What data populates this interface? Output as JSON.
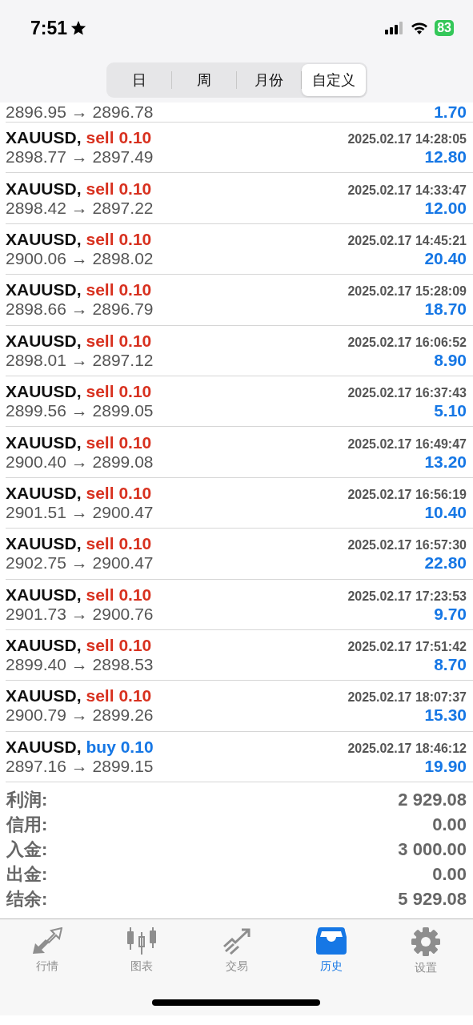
{
  "status_bar": {
    "time": "7:51",
    "battery": "83"
  },
  "period_tabs": [
    {
      "label": "日",
      "selected": false
    },
    {
      "label": "周",
      "selected": false
    },
    {
      "label": "月份",
      "selected": false
    },
    {
      "label": "自定义",
      "selected": true
    }
  ],
  "partial_deal": {
    "prices": "2896.95 → 2896.78",
    "profit": "1.70"
  },
  "deals": [
    {
      "symbol": "XAUUSD,",
      "side": "sell",
      "volume": "0.10",
      "time": "2025.02.17 14:28:05",
      "prices": "2898.77 → 2897.49",
      "profit": "12.80"
    },
    {
      "symbol": "XAUUSD,",
      "side": "sell",
      "volume": "0.10",
      "time": "2025.02.17 14:33:47",
      "prices": "2898.42 → 2897.22",
      "profit": "12.00"
    },
    {
      "symbol": "XAUUSD,",
      "side": "sell",
      "volume": "0.10",
      "time": "2025.02.17 14:45:21",
      "prices": "2900.06 → 2898.02",
      "profit": "20.40"
    },
    {
      "symbol": "XAUUSD,",
      "side": "sell",
      "volume": "0.10",
      "time": "2025.02.17 15:28:09",
      "prices": "2898.66 → 2896.79",
      "profit": "18.70"
    },
    {
      "symbol": "XAUUSD,",
      "side": "sell",
      "volume": "0.10",
      "time": "2025.02.17 16:06:52",
      "prices": "2898.01 → 2897.12",
      "profit": "8.90"
    },
    {
      "symbol": "XAUUSD,",
      "side": "sell",
      "volume": "0.10",
      "time": "2025.02.17 16:37:43",
      "prices": "2899.56 → 2899.05",
      "profit": "5.10"
    },
    {
      "symbol": "XAUUSD,",
      "side": "sell",
      "volume": "0.10",
      "time": "2025.02.17 16:49:47",
      "prices": "2900.40 → 2899.08",
      "profit": "13.20"
    },
    {
      "symbol": "XAUUSD,",
      "side": "sell",
      "volume": "0.10",
      "time": "2025.02.17 16:56:19",
      "prices": "2901.51 → 2900.47",
      "profit": "10.40"
    },
    {
      "symbol": "XAUUSD,",
      "side": "sell",
      "volume": "0.10",
      "time": "2025.02.17 16:57:30",
      "prices": "2902.75 → 2900.47",
      "profit": "22.80"
    },
    {
      "symbol": "XAUUSD,",
      "side": "sell",
      "volume": "0.10",
      "time": "2025.02.17 17:23:53",
      "prices": "2901.73 → 2900.76",
      "profit": "9.70"
    },
    {
      "symbol": "XAUUSD,",
      "side": "sell",
      "volume": "0.10",
      "time": "2025.02.17 17:51:42",
      "prices": "2899.40 → 2898.53",
      "profit": "8.70"
    },
    {
      "symbol": "XAUUSD,",
      "side": "sell",
      "volume": "0.10",
      "time": "2025.02.17 18:07:37",
      "prices": "2900.79 → 2899.26",
      "profit": "15.30"
    },
    {
      "symbol": "XAUUSD,",
      "side": "buy",
      "volume": "0.10",
      "time": "2025.02.17 18:46:12",
      "prices": "2897.16 → 2899.15",
      "profit": "19.90"
    }
  ],
  "summary": [
    {
      "label": "利润:",
      "value": "2 929.08"
    },
    {
      "label": "信用:",
      "value": "0.00"
    },
    {
      "label": "入金:",
      "value": "3 000.00"
    },
    {
      "label": "出金:",
      "value": "0.00"
    },
    {
      "label": "结余:",
      "value": "5 929.08"
    }
  ],
  "tab_bar": [
    {
      "kind": "quotes",
      "label": "行情",
      "selected": false
    },
    {
      "kind": "chart",
      "label": "图表",
      "selected": false
    },
    {
      "kind": "trade",
      "label": "交易",
      "selected": false
    },
    {
      "kind": "history",
      "label": "历史",
      "selected": true
    },
    {
      "kind": "settings",
      "label": "设置",
      "selected": false
    }
  ]
}
